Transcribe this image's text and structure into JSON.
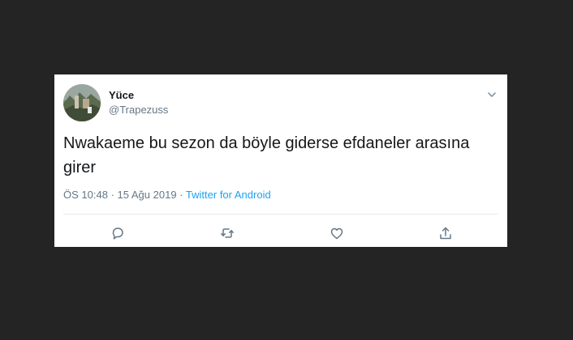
{
  "tweet": {
    "display_name": "Yüce",
    "handle": "@Trapezuss",
    "text": "Nwakaeme bu sezon da böyle giderse efdaneler arasına girer",
    "time": "ÖS 10:48",
    "date": "15 Ağu 2019",
    "separator": "·",
    "source": "Twitter for Android"
  },
  "icons": {
    "menu": "chevron-down-icon",
    "reply": "reply-icon",
    "retweet": "retweet-icon",
    "like": "heart-icon",
    "share": "share-icon"
  },
  "colors": {
    "background": "#242424",
    "card": "#ffffff",
    "text": "#14171a",
    "secondary": "#657786",
    "link": "#1da1f2"
  }
}
